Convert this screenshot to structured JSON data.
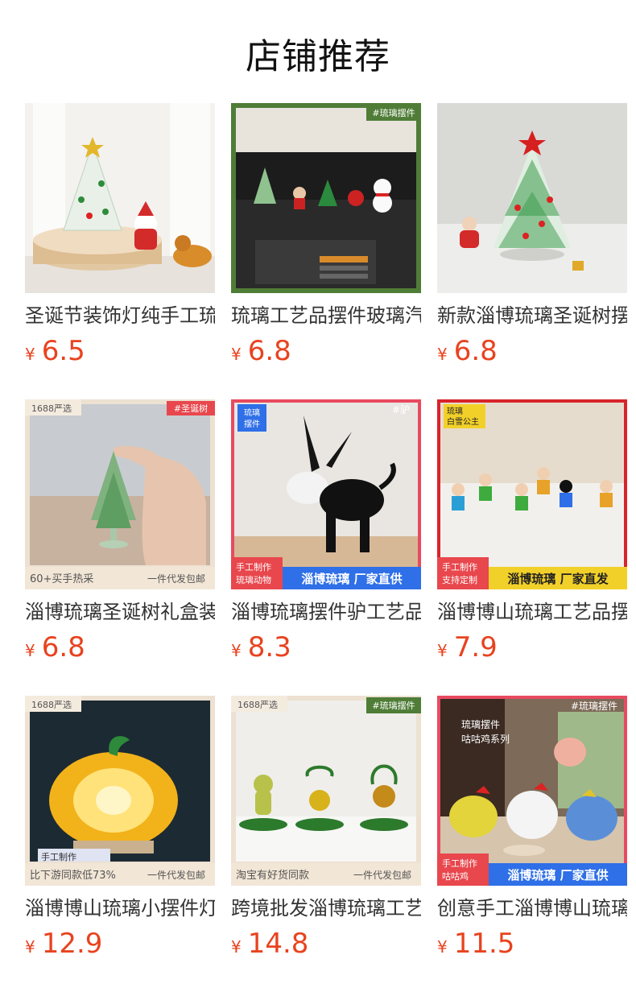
{
  "page": {
    "title": "店铺推荐"
  },
  "currency_symbol": "¥",
  "colors": {
    "price": "#e8431f",
    "title": "#111111",
    "name": "#333333"
  },
  "products": [
    {
      "name": "圣诞节装饰灯纯手工琉璃摆件",
      "price": "6.5",
      "badges": {}
    },
    {
      "name": "琉璃工艺品摆件玻璃汽车摆件",
      "price": "6.8",
      "badges": {
        "tag": "#琉璃摆件"
      }
    },
    {
      "name": "新款淄博琉璃圣诞树摆件",
      "price": "6.8",
      "badges": {}
    },
    {
      "name": "淄博琉璃圣诞树礼盒装摆件",
      "price": "6.8",
      "badges": {
        "corner": "1688严选",
        "tag": "#圣诞树",
        "bottom_left": "60+买手热采",
        "bottom_right": "一件代发包邮"
      }
    },
    {
      "name": "淄博琉璃摆件驴工艺品摆件",
      "price": "8.3",
      "badges": {
        "corner_line1": "琉璃",
        "corner_line2": "摆件",
        "tag": "#驴",
        "side_line1": "手工制作",
        "side_line2": "琉璃动物",
        "banner": "淄博琉璃 厂家直供"
      }
    },
    {
      "name": "淄博博山琉璃工艺品摆件",
      "price": "7.9",
      "badges": {
        "corner_line1": "琉璃",
        "corner_line2": "白雪公主",
        "side_line1": "手工制作",
        "side_line2": "支持定制",
        "banner": "淄博琉璃 厂家直发"
      }
    },
    {
      "name": "淄博博山琉璃小摆件灯",
      "price": "12.9",
      "badges": {
        "corner": "1688严选",
        "sign": "手工制作",
        "bottom_left": "比下游同款低73%",
        "bottom_right": "一件代发包邮"
      }
    },
    {
      "name": "跨境批发淄博琉璃工艺品",
      "price": "14.8",
      "badges": {
        "corner": "1688严选",
        "tag": "#琉璃摆件",
        "bottom_left": "淘宝有好货同款",
        "bottom_right": "一件代发包邮"
      }
    },
    {
      "name": "创意手工淄博博山琉璃摆件",
      "price": "11.5",
      "badges": {
        "tag": "#琉璃摆件",
        "vertical_1": "琉璃摆件",
        "vertical_2": "咕咕鸡系列",
        "side_line1": "手工制作",
        "side_line2": "咕咕鸡",
        "banner": "淄博琉璃 厂家直供"
      }
    }
  ]
}
